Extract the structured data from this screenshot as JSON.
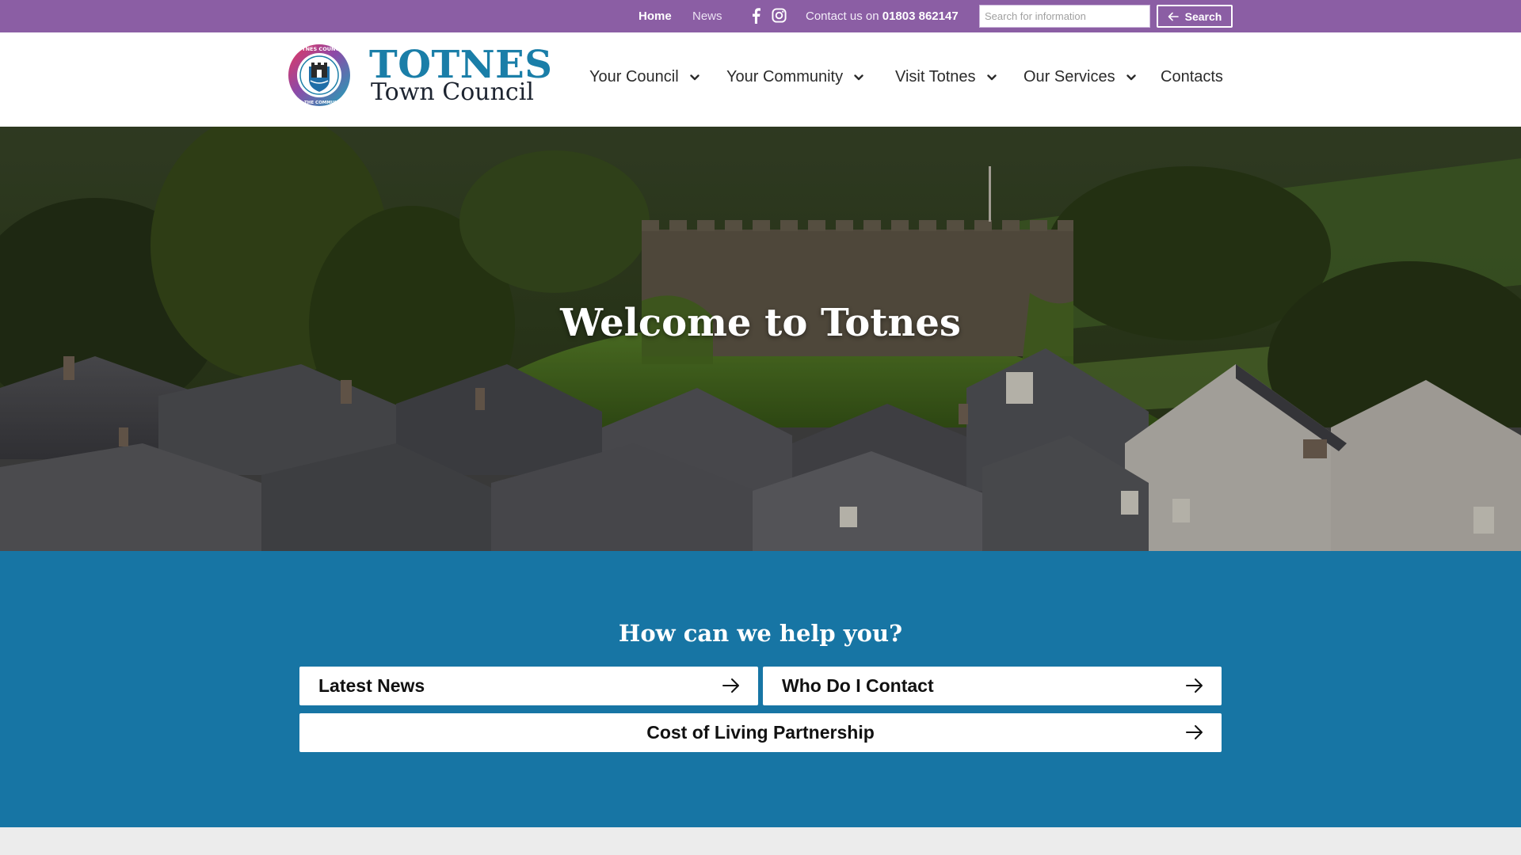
{
  "topbar": {
    "home_label": "Home",
    "news_label": "News",
    "contact_prefix": "Contact us on",
    "contact_phone": "01803 862147",
    "search_placeholder": "Search for information",
    "search_label": "Search",
    "background_color": "#8b5ea4",
    "social_icons": [
      "facebook-icon",
      "instagram-icon"
    ]
  },
  "header": {
    "logo_title": "TOTNES",
    "logo_subtitle": "Town Council",
    "logo_ring_text_top": "TOTNES COUNCIL",
    "logo_ring_text_bottom": "FOR THE COMMUNITY",
    "brand_color": "#1a7ea8",
    "nav": [
      {
        "label": "Your Council",
        "has_dropdown": true
      },
      {
        "label": "Your Community",
        "has_dropdown": true
      },
      {
        "label": "Visit Totnes",
        "has_dropdown": true
      },
      {
        "label": "Our Services",
        "has_dropdown": true
      },
      {
        "label": "Contacts",
        "has_dropdown": false
      }
    ]
  },
  "hero": {
    "title": "Welcome to Totnes"
  },
  "help": {
    "title": "How can we help you?",
    "background_color": "#1775a4",
    "tiles": [
      {
        "label": "Latest News",
        "icon": "arrow-right-icon"
      },
      {
        "label": "Who Do I Contact",
        "icon": "arrow-right-icon"
      },
      {
        "label": "Cost of Living Partnership",
        "icon": "arrow-right-icon"
      }
    ]
  }
}
